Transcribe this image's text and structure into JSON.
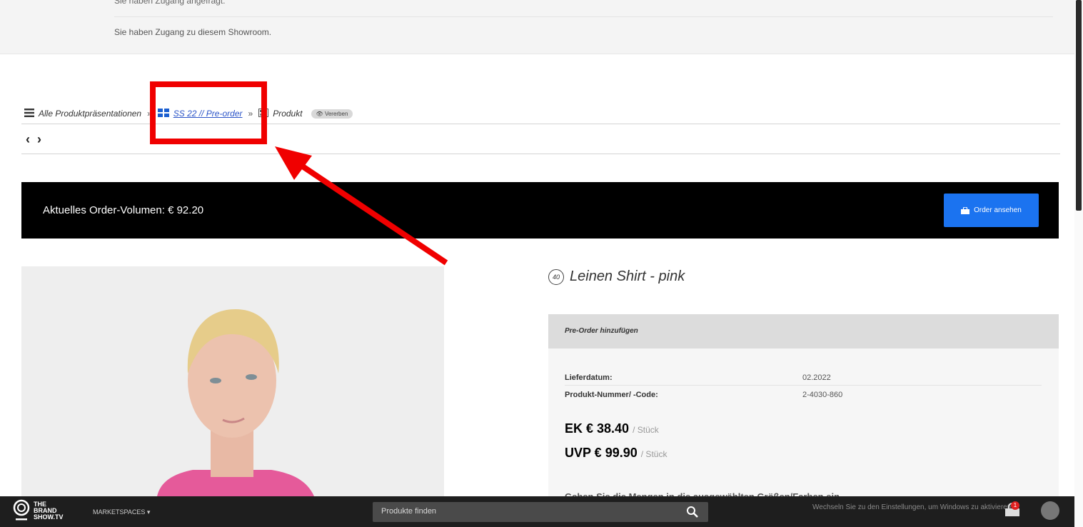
{
  "top": {
    "message_cut": "Sie haben Zugang angefragt.",
    "message": "Sie haben Zugang zu diesem Showroom."
  },
  "breadcrumb": {
    "all_label": "Alle Produktpräsentationen",
    "collection_label": "SS 22 // Pre-order",
    "product_label": "Produkt",
    "badge_label": "Vererben",
    "separator": "»"
  },
  "nav": {
    "prev": "‹",
    "next": "›"
  },
  "order_bar": {
    "volume_text": "Aktuelles Order-Volumen: € 92.20",
    "button_label": "Order ansehen"
  },
  "product": {
    "number": "40",
    "title": "Leinen Shirt - pink",
    "panel_header": "Pre-Order hinzufügen",
    "delivery_label": "Lieferdatum:",
    "delivery_value": "02.2022",
    "code_label": "Produkt-Nummer/ -Code:",
    "code_value": "2-4030-860",
    "ek_price": "EK € 38.40",
    "uvp_price": "UVP € 99.90",
    "unit": "/ Stück",
    "cut_text": "Geben Sie die Mengen in die ausgewählten Größen/Farben ein"
  },
  "bottombar": {
    "brand_line1": "THE",
    "brand_line2": "BRAND",
    "brand_line3": "SHOW.TV",
    "marketspaces": "MARKETSPACES ▾",
    "search_placeholder": "Produkte finden",
    "windows_msg": "Wechseln Sie zu den Einstellungen, um Windows zu aktivieren.",
    "cart_count": "1"
  },
  "colors": {
    "accent_blue": "#1b73f0",
    "link_blue": "#2b54c8",
    "annotation_red": "#f00000"
  }
}
